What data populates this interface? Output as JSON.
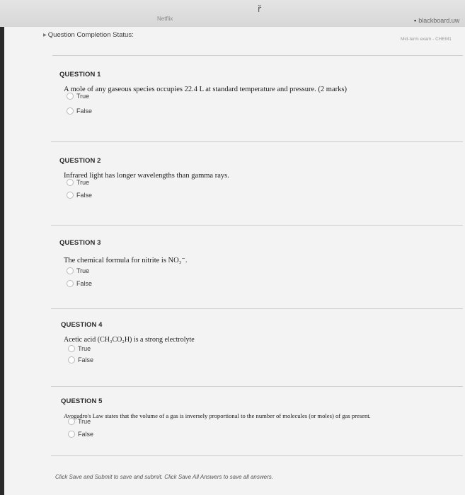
{
  "browser": {
    "tab_netflix": "Netflix",
    "app_icon_glyph": "ȑ",
    "tab_blackboard": "blackboard.uw",
    "subtab": "Mid-term exam - CHEM1"
  },
  "page": {
    "status_label": "Question Completion Status:"
  },
  "questions": [
    {
      "title": "QUESTION 1",
      "text": "A mole of any gaseous species occupies 22.4 L at standard temperature and pressure. (2 marks)",
      "options": [
        "True",
        "False"
      ]
    },
    {
      "title": "QUESTION 2",
      "text": "Infrared light has longer wavelengths than gamma rays.",
      "options": [
        "True",
        "False"
      ]
    },
    {
      "title": "QUESTION 3",
      "text": "The chemical formula for nitrite is NO₃⁻.",
      "options": [
        "True",
        "False"
      ]
    },
    {
      "title": "QUESTION 4",
      "text": "Acetic acid (CH₃CO₂H) is a strong electrolyte",
      "options": [
        "True",
        "False"
      ]
    },
    {
      "title": "QUESTION 5",
      "text": "Avogadro's Law states that the volume of a gas is inversely proportional to the number of molecules (or moles) of gas present.",
      "options": [
        "True",
        "False"
      ]
    }
  ],
  "footer": {
    "note": "Click Save and Submit to save and submit. Click Save All Answers to save all answers."
  }
}
